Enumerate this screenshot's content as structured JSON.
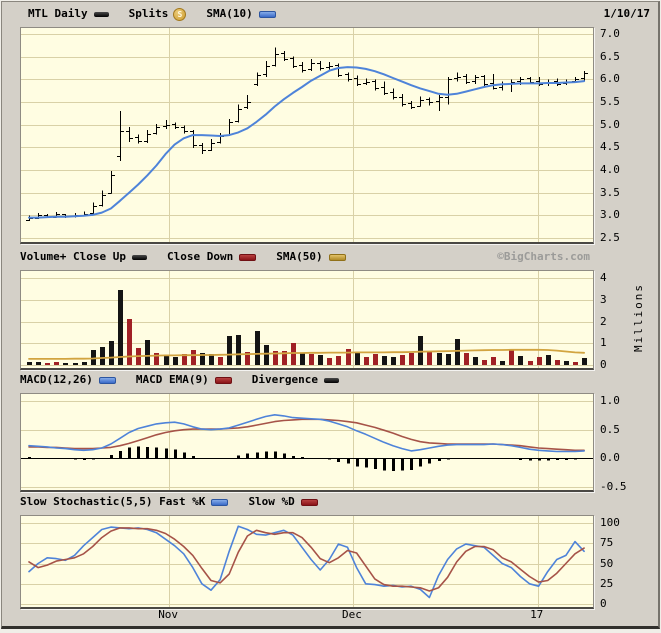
{
  "app": {
    "name": "BigCharts stock chart",
    "symbol": "MTL",
    "frequency": "Daily",
    "date": "1/10/17"
  },
  "colors": {
    "page_bg": "#D4D0C8",
    "panel_bg": "#FFFDE2",
    "grid": "#D9D1A7",
    "blue_line": "#4E83D9",
    "red_line": "#A65348",
    "gold_line": "#D2A440",
    "volume_up": "#141414",
    "volume_down": "#A02025",
    "bar_black": "#000000"
  },
  "panels": [
    {
      "legend": [
        {
          "label": "MTL Daily",
          "swatch": "black"
        },
        {
          "label": "Splits",
          "swatch": "splits"
        },
        {
          "label": "SMA(10)",
          "swatch": "blue"
        }
      ],
      "right_text": "1/10/17"
    },
    {
      "legend": [
        {
          "label": "Volume+ Close Up",
          "swatch": "black"
        },
        {
          "label": "Close Down",
          "swatch": "red"
        },
        {
          "label": "SMA(50)",
          "swatch": "gold"
        }
      ],
      "right_text": "©BigCharts.com"
    },
    {
      "legend": [
        {
          "label": "MACD(12,26)",
          "swatch": "blue"
        },
        {
          "label": "MACD EMA(9)",
          "swatch": "red"
        },
        {
          "label": "Divergence",
          "swatch": "black"
        }
      ],
      "right_text": ""
    },
    {
      "legend": [
        {
          "label": "Slow Stochastic(5,5) Fast %K",
          "swatch": "blue"
        },
        {
          "label": "Slow %D",
          "swatch": "red"
        }
      ],
      "right_text": ""
    }
  ],
  "xaxis": {
    "ticks": [
      {
        "label": "Nov",
        "index": 15.4
      },
      {
        "label": "Dec",
        "index": 35.6
      },
      {
        "label": "17",
        "index": 55.9
      }
    ]
  },
  "chart_data": [
    {
      "type": "ohlc+line",
      "title": "MTL Daily price with SMA(10)",
      "ylim": [
        2.5,
        7.0
      ],
      "yticks": [
        "7.0",
        "6.5",
        "6.0",
        "5.5",
        "5.0",
        "4.5",
        "4.0",
        "3.5",
        "3.0",
        "2.5"
      ],
      "series": [
        {
          "name": "MTL Daily OHLC",
          "type": "ohlc",
          "open": [
            2.9,
            2.95,
            3.0,
            2.97,
            3.02,
            2.98,
            3.0,
            3.05,
            3.22,
            3.5,
            4.3,
            4.85,
            4.72,
            4.65,
            4.82,
            4.97,
            5.02,
            4.95,
            4.85,
            4.55,
            4.45,
            4.62,
            4.78,
            5.08,
            5.38,
            5.9,
            6.12,
            6.32,
            6.57,
            6.47,
            6.32,
            6.22,
            6.37,
            6.27,
            6.32,
            6.12,
            6.02,
            5.92,
            5.97,
            5.82,
            5.72,
            5.62,
            5.47,
            5.42,
            5.57,
            5.52,
            5.62,
            6.02,
            6.07,
            5.97,
            6.07,
            5.92,
            5.82,
            5.92,
            5.97,
            6.02,
            5.97,
            5.92,
            5.97,
            5.92,
            5.97,
            6.02
          ],
          "high": [
            3.0,
            3.05,
            3.03,
            3.07,
            3.03,
            3.05,
            3.08,
            3.28,
            3.55,
            3.98,
            5.3,
            4.95,
            4.78,
            4.88,
            5.02,
            5.1,
            5.05,
            4.98,
            4.88,
            4.6,
            4.68,
            4.82,
            5.12,
            5.45,
            5.65,
            6.15,
            6.4,
            6.7,
            6.62,
            6.5,
            6.38,
            6.45,
            6.4,
            6.38,
            6.35,
            6.15,
            6.08,
            6.02,
            6.0,
            5.95,
            5.8,
            5.68,
            5.52,
            5.62,
            5.6,
            5.65,
            6.05,
            6.15,
            6.12,
            6.1,
            6.1,
            6.12,
            5.95,
            6.0,
            6.05,
            6.05,
            6.05,
            6.0,
            6.02,
            6.0,
            6.05,
            6.18
          ],
          "low": [
            2.88,
            2.92,
            2.94,
            2.95,
            2.94,
            2.95,
            2.97,
            3.03,
            3.2,
            3.48,
            4.2,
            4.62,
            4.58,
            4.6,
            4.78,
            4.9,
            4.9,
            4.8,
            4.48,
            4.35,
            4.42,
            4.58,
            4.75,
            5.05,
            5.35,
            5.85,
            6.05,
            6.28,
            6.4,
            6.25,
            6.15,
            6.18,
            6.2,
            6.22,
            6.05,
            5.95,
            5.85,
            5.88,
            5.75,
            5.65,
            5.55,
            5.4,
            5.35,
            5.4,
            5.42,
            5.3,
            5.45,
            5.95,
            5.9,
            5.9,
            5.85,
            5.78,
            5.75,
            5.72,
            5.88,
            5.9,
            5.85,
            5.85,
            5.85,
            5.88,
            5.92,
            5.95
          ],
          "close": [
            2.95,
            3.0,
            2.97,
            3.02,
            2.98,
            3.0,
            3.02,
            3.2,
            3.45,
            3.9,
            4.85,
            4.7,
            4.65,
            4.8,
            4.95,
            5.0,
            4.95,
            4.85,
            4.55,
            4.45,
            4.6,
            4.75,
            5.05,
            5.35,
            5.5,
            6.1,
            6.3,
            6.55,
            6.45,
            6.3,
            6.2,
            6.35,
            6.25,
            6.3,
            6.1,
            6.0,
            5.9,
            5.95,
            5.8,
            5.7,
            5.6,
            5.45,
            5.4,
            5.55,
            5.5,
            5.6,
            6.0,
            6.05,
            5.95,
            6.05,
            5.9,
            5.8,
            5.9,
            5.95,
            6.0,
            5.95,
            5.9,
            5.95,
            5.9,
            5.95,
            6.0,
            6.15
          ]
        },
        {
          "name": "SMA(10)",
          "type": "line",
          "color": "#4E83D9",
          "values": [
            2.95,
            2.95,
            2.96,
            2.97,
            2.97,
            2.98,
            2.99,
            3.01,
            3.06,
            3.15,
            3.32,
            3.5,
            3.68,
            3.88,
            4.1,
            4.35,
            4.56,
            4.7,
            4.77,
            4.77,
            4.76,
            4.75,
            4.77,
            4.83,
            4.92,
            5.06,
            5.22,
            5.4,
            5.56,
            5.7,
            5.83,
            5.97,
            6.08,
            6.19,
            6.25,
            6.27,
            6.26,
            6.23,
            6.18,
            6.11,
            6.03,
            5.95,
            5.87,
            5.8,
            5.74,
            5.68,
            5.66,
            5.68,
            5.73,
            5.78,
            5.83,
            5.87,
            5.89,
            5.9,
            5.91,
            5.91,
            5.91,
            5.92,
            5.92,
            5.93,
            5.94,
            5.96
          ]
        }
      ]
    },
    {
      "type": "bar",
      "title": "Volume",
      "ylabel": "Millions",
      "ylim": [
        0,
        4
      ],
      "yticks": [
        "4",
        "3",
        "2",
        "1",
        "0"
      ],
      "series": [
        {
          "name": "Volume",
          "type": "bar",
          "values": [
            0.15,
            0.12,
            0.1,
            0.12,
            0.08,
            0.1,
            0.12,
            0.7,
            0.85,
            1.1,
            3.45,
            2.1,
            0.8,
            1.15,
            0.55,
            0.45,
            0.35,
            0.5,
            0.7,
            0.55,
            0.5,
            0.35,
            1.35,
            1.4,
            0.6,
            1.55,
            0.9,
            0.65,
            0.65,
            1.0,
            0.55,
            0.5,
            0.45,
            0.3,
            0.4,
            0.75,
            0.55,
            0.35,
            0.5,
            0.4,
            0.35,
            0.45,
            0.55,
            1.35,
            0.6,
            0.55,
            0.5,
            1.2,
            0.55,
            0.35,
            0.25,
            0.35,
            0.2,
            0.75,
            0.4,
            0.2,
            0.35,
            0.45,
            0.25,
            0.2,
            0.15,
            0.3
          ],
          "direction": [
            "u",
            "u",
            "d",
            "d",
            "u",
            "u",
            "u",
            "u",
            "u",
            "u",
            "u",
            "d",
            "d",
            "u",
            "d",
            "u",
            "u",
            "d",
            "d",
            "u",
            "u",
            "d",
            "u",
            "u",
            "d",
            "u",
            "u",
            "d",
            "d",
            "d",
            "u",
            "d",
            "u",
            "d",
            "d",
            "d",
            "u",
            "d",
            "d",
            "u",
            "u",
            "d",
            "d",
            "u",
            "d",
            "u",
            "u",
            "u",
            "d",
            "u",
            "d",
            "d",
            "u",
            "d",
            "u",
            "d",
            "d",
            "u",
            "d",
            "u",
            "d",
            "u"
          ]
        },
        {
          "name": "SMA(50)",
          "type": "line",
          "color": "#D2A440",
          "values": [
            0.28,
            0.28,
            0.28,
            0.28,
            0.28,
            0.29,
            0.29,
            0.3,
            0.32,
            0.34,
            0.37,
            0.39,
            0.41,
            0.42,
            0.43,
            0.44,
            0.44,
            0.45,
            0.45,
            0.46,
            0.46,
            0.47,
            0.48,
            0.49,
            0.5,
            0.51,
            0.52,
            0.53,
            0.54,
            0.55,
            0.55,
            0.56,
            0.56,
            0.57,
            0.57,
            0.57,
            0.58,
            0.58,
            0.58,
            0.58,
            0.59,
            0.59,
            0.6,
            0.61,
            0.62,
            0.63,
            0.64,
            0.65,
            0.66,
            0.67,
            0.68,
            0.69,
            0.69,
            0.7,
            0.7,
            0.7,
            0.7,
            0.69,
            0.66,
            0.62,
            0.58,
            0.56
          ]
        }
      ]
    },
    {
      "type": "line+hist",
      "title": "MACD",
      "ylim": [
        -0.5,
        1.0
      ],
      "yticks": [
        "1.0",
        "0.5",
        "0.0",
        "-0.5"
      ],
      "series": [
        {
          "name": "MACD(12,26)",
          "type": "line",
          "color": "#4E83D9",
          "values": [
            0.22,
            0.21,
            0.2,
            0.18,
            0.17,
            0.15,
            0.14,
            0.15,
            0.18,
            0.25,
            0.35,
            0.45,
            0.52,
            0.56,
            0.6,
            0.62,
            0.63,
            0.6,
            0.55,
            0.51,
            0.5,
            0.51,
            0.53,
            0.58,
            0.63,
            0.68,
            0.73,
            0.76,
            0.74,
            0.71,
            0.7,
            0.69,
            0.68,
            0.65,
            0.6,
            0.55,
            0.48,
            0.42,
            0.35,
            0.28,
            0.22,
            0.17,
            0.13,
            0.15,
            0.18,
            0.21,
            0.23,
            0.24,
            0.24,
            0.24,
            0.24,
            0.25,
            0.24,
            0.22,
            0.19,
            0.16,
            0.14,
            0.13,
            0.12,
            0.12,
            0.12,
            0.13
          ]
        },
        {
          "name": "MACD EMA(9)",
          "type": "line",
          "color": "#A65348",
          "values": [
            0.2,
            0.2,
            0.19,
            0.19,
            0.18,
            0.17,
            0.17,
            0.17,
            0.18,
            0.19,
            0.22,
            0.26,
            0.31,
            0.36,
            0.41,
            0.45,
            0.48,
            0.5,
            0.51,
            0.51,
            0.51,
            0.51,
            0.52,
            0.53,
            0.55,
            0.58,
            0.61,
            0.64,
            0.66,
            0.67,
            0.68,
            0.68,
            0.68,
            0.67,
            0.66,
            0.64,
            0.62,
            0.58,
            0.54,
            0.49,
            0.44,
            0.38,
            0.33,
            0.29,
            0.27,
            0.26,
            0.25,
            0.25,
            0.25,
            0.25,
            0.25,
            0.25,
            0.24,
            0.23,
            0.22,
            0.2,
            0.18,
            0.17,
            0.16,
            0.15,
            0.14,
            0.14
          ]
        },
        {
          "name": "Divergence",
          "type": "hist",
          "color": "#000000",
          "values": [
            0.02,
            0.01,
            0.01,
            -0.01,
            -0.01,
            -0.02,
            -0.03,
            -0.02,
            0.0,
            0.06,
            0.13,
            0.19,
            0.21,
            0.2,
            0.19,
            0.17,
            0.15,
            0.1,
            0.04,
            0.0,
            -0.01,
            0.0,
            0.01,
            0.05,
            0.08,
            0.1,
            0.12,
            0.12,
            0.08,
            0.04,
            0.02,
            0.01,
            0.0,
            -0.02,
            -0.06,
            -0.09,
            -0.14,
            -0.16,
            -0.19,
            -0.21,
            -0.22,
            -0.21,
            -0.2,
            -0.14,
            -0.09,
            -0.05,
            -0.02,
            -0.01,
            -0.01,
            -0.01,
            -0.01,
            0.0,
            0.0,
            -0.01,
            -0.03,
            -0.04,
            -0.04,
            -0.04,
            -0.03,
            -0.03,
            -0.02,
            -0.01
          ]
        }
      ]
    },
    {
      "type": "line",
      "title": "Slow Stochastic(5,5)",
      "ylim": [
        0,
        100
      ],
      "yticks": [
        "100",
        "75",
        "50",
        "25",
        "0"
      ],
      "series": [
        {
          "name": "Fast %K",
          "type": "line",
          "color": "#4E83D9",
          "values": [
            40,
            50,
            57,
            56,
            54,
            60,
            72,
            82,
            92,
            95,
            94,
            93,
            94,
            92,
            88,
            80,
            72,
            62,
            45,
            25,
            17,
            30,
            65,
            96,
            92,
            86,
            85,
            88,
            91,
            85,
            70,
            55,
            42,
            55,
            74,
            70,
            45,
            25,
            24,
            22,
            23,
            21,
            22,
            18,
            8,
            35,
            55,
            68,
            74,
            72,
            70,
            60,
            50,
            45,
            34,
            25,
            22,
            40,
            55,
            60,
            77,
            65
          ]
        },
        {
          "name": "Slow %D",
          "type": "line",
          "color": "#A65348",
          "values": [
            52,
            45,
            48,
            53,
            55,
            57,
            62,
            71,
            82,
            90,
            94,
            94,
            93,
            93,
            91,
            87,
            80,
            71,
            60,
            44,
            29,
            26,
            37,
            64,
            84,
            91,
            88,
            86,
            88,
            88,
            82,
            70,
            56,
            51,
            57,
            66,
            63,
            47,
            31,
            24,
            22,
            22,
            21,
            20,
            16,
            20,
            33,
            52,
            65,
            71,
            71,
            67,
            57,
            52,
            43,
            34,
            27,
            29,
            38,
            50,
            62,
            69
          ]
        }
      ]
    }
  ]
}
